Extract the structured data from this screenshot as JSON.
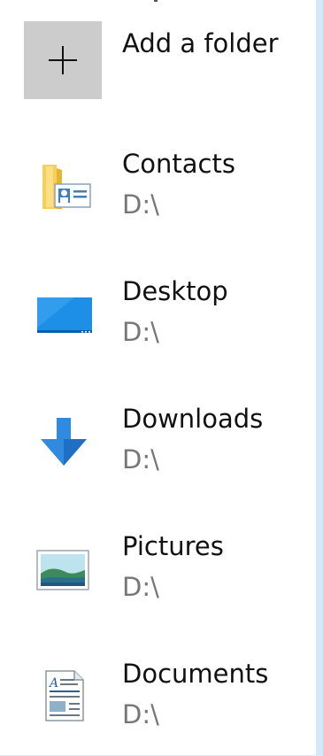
{
  "add_folder": {
    "label": "Add a folder"
  },
  "folders": [
    {
      "name": "Contacts",
      "path": "D:\\",
      "icon": "contacts-folder-icon"
    },
    {
      "name": "Desktop",
      "path": "D:\\",
      "icon": "desktop-icon"
    },
    {
      "name": "Downloads",
      "path": "D:\\",
      "icon": "downloads-icon"
    },
    {
      "name": "Pictures",
      "path": "D:\\",
      "icon": "pictures-icon"
    },
    {
      "name": "Documents",
      "path": "D:\\",
      "icon": "documents-icon"
    }
  ],
  "colors": {
    "background": "#ffffff",
    "add_tile": "#cccccc",
    "right_edge": "#d4e8f6",
    "secondary_text": "#777777"
  }
}
